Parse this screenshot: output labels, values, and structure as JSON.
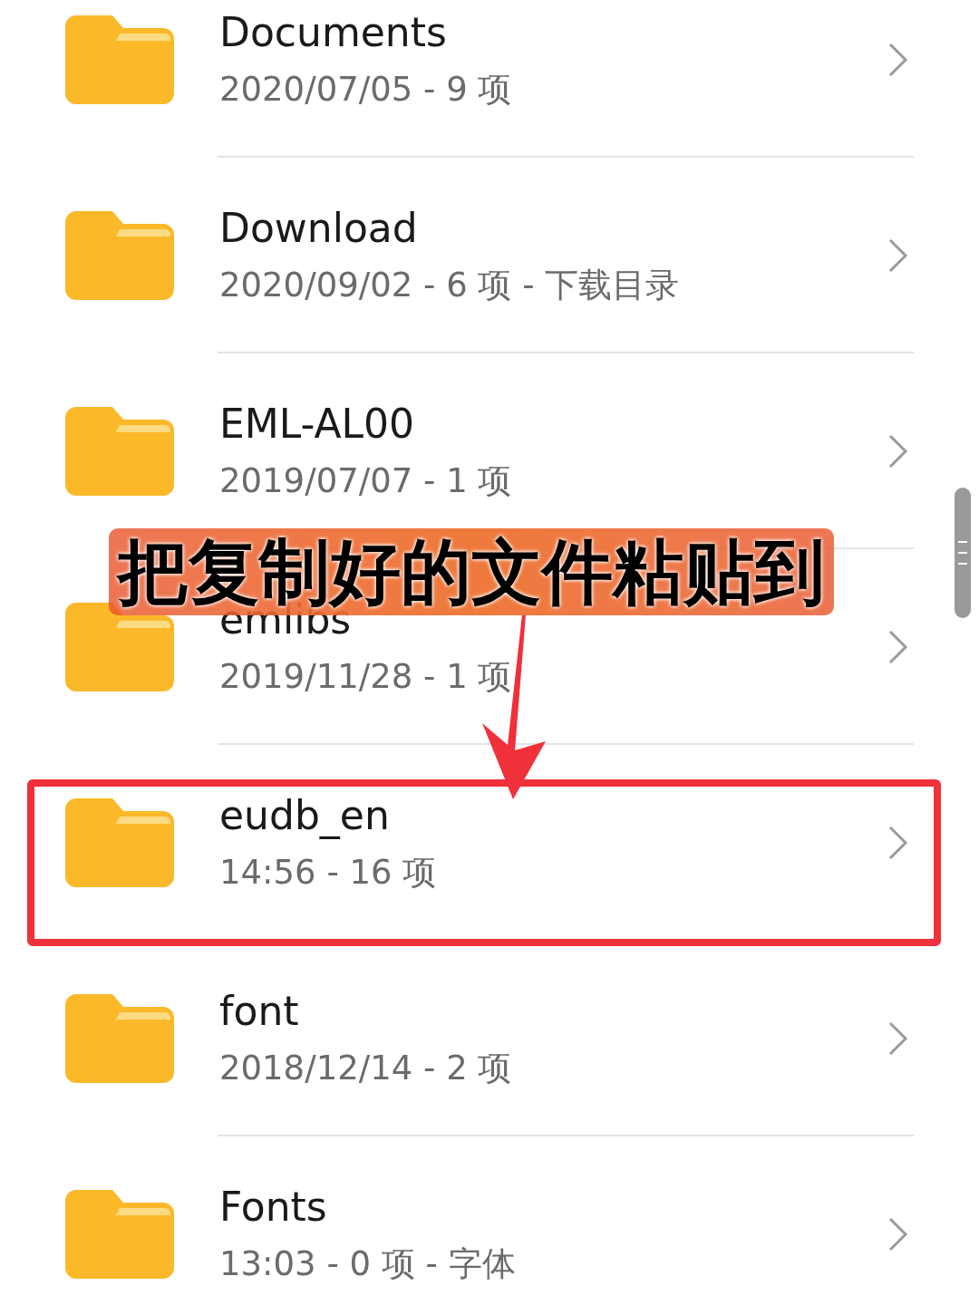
{
  "folders": [
    {
      "name": "Documents",
      "meta": "2020/07/05 - 9 项",
      "highlighted": false
    },
    {
      "name": "Download",
      "meta": "2020/09/02 - 6 项 - 下载目录",
      "highlighted": false
    },
    {
      "name": "EML-AL00",
      "meta": "2019/07/07 - 1 项",
      "highlighted": false
    },
    {
      "name": "emlibs",
      "meta": "2019/11/28 - 1 项",
      "highlighted": false
    },
    {
      "name": "eudb_en",
      "meta": "14:56 - 16 项",
      "highlighted": true
    },
    {
      "name": "font",
      "meta": "2018/12/14 - 2 项",
      "highlighted": false
    },
    {
      "name": "Fonts",
      "meta": "13:03 - 0 项 - 字体",
      "highlighted": false
    }
  ],
  "annotation": {
    "caption": "把复制好的文件粘贴到"
  }
}
